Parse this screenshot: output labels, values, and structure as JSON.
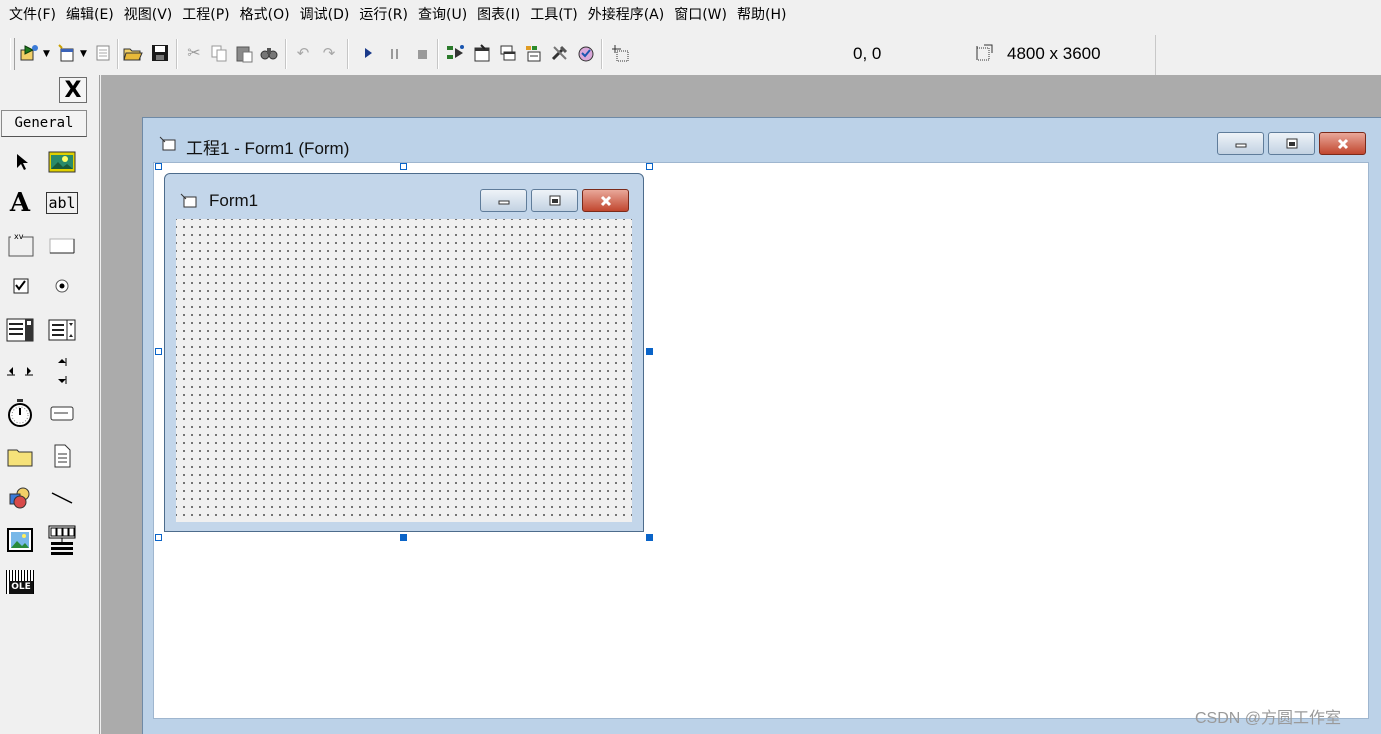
{
  "menu": [
    "文件(F)",
    "编辑(E)",
    "视图(V)",
    "工程(P)",
    "格式(O)",
    "调试(D)",
    "运行(R)",
    "查询(U)",
    "图表(I)",
    "工具(T)",
    "外接程序(A)",
    "窗口(W)",
    "帮助(H)"
  ],
  "toolbar": {
    "position_value": "0, 0",
    "size_value": "4800 x 3600",
    "icons": [
      "add-project-icon",
      "add-form-icon",
      "menu-editor-icon",
      "open-icon",
      "save-icon",
      "cut-icon",
      "copy-icon",
      "paste-icon",
      "find-icon",
      "undo-icon",
      "redo-icon",
      "start-icon",
      "break-icon",
      "end-icon",
      "project-explorer-icon",
      "properties-icon",
      "form-layout-icon",
      "object-browser-icon",
      "toolbox-icon",
      "data-view-icon",
      "position-icon",
      "size-icon"
    ]
  },
  "toolbox": {
    "close_label": "X",
    "tab_label": "General",
    "tools": [
      "pointer-icon",
      "picturebox-icon",
      "label-icon",
      "textbox-icon",
      "frame-icon",
      "commandbutton-icon",
      "checkbox-icon",
      "optionbutton-icon",
      "combobox-icon",
      "listbox-icon",
      "hscrollbar-icon",
      "vscrollbar-icon",
      "timer-icon",
      "drivelistbox-icon",
      "dirlistbox-icon",
      "filelistbox-icon",
      "shape-icon",
      "line-icon",
      "image-icon",
      "data-icon",
      "ole-icon"
    ],
    "label_glyph": "A",
    "textbox_glyph": "abl",
    "frame_glyph": "xv",
    "ole_glyph": "OLE"
  },
  "project_window": {
    "title": "工程1 - Form1 (Form)"
  },
  "form": {
    "title": "Form1"
  },
  "watermark": "CSDN @方圆工作室"
}
